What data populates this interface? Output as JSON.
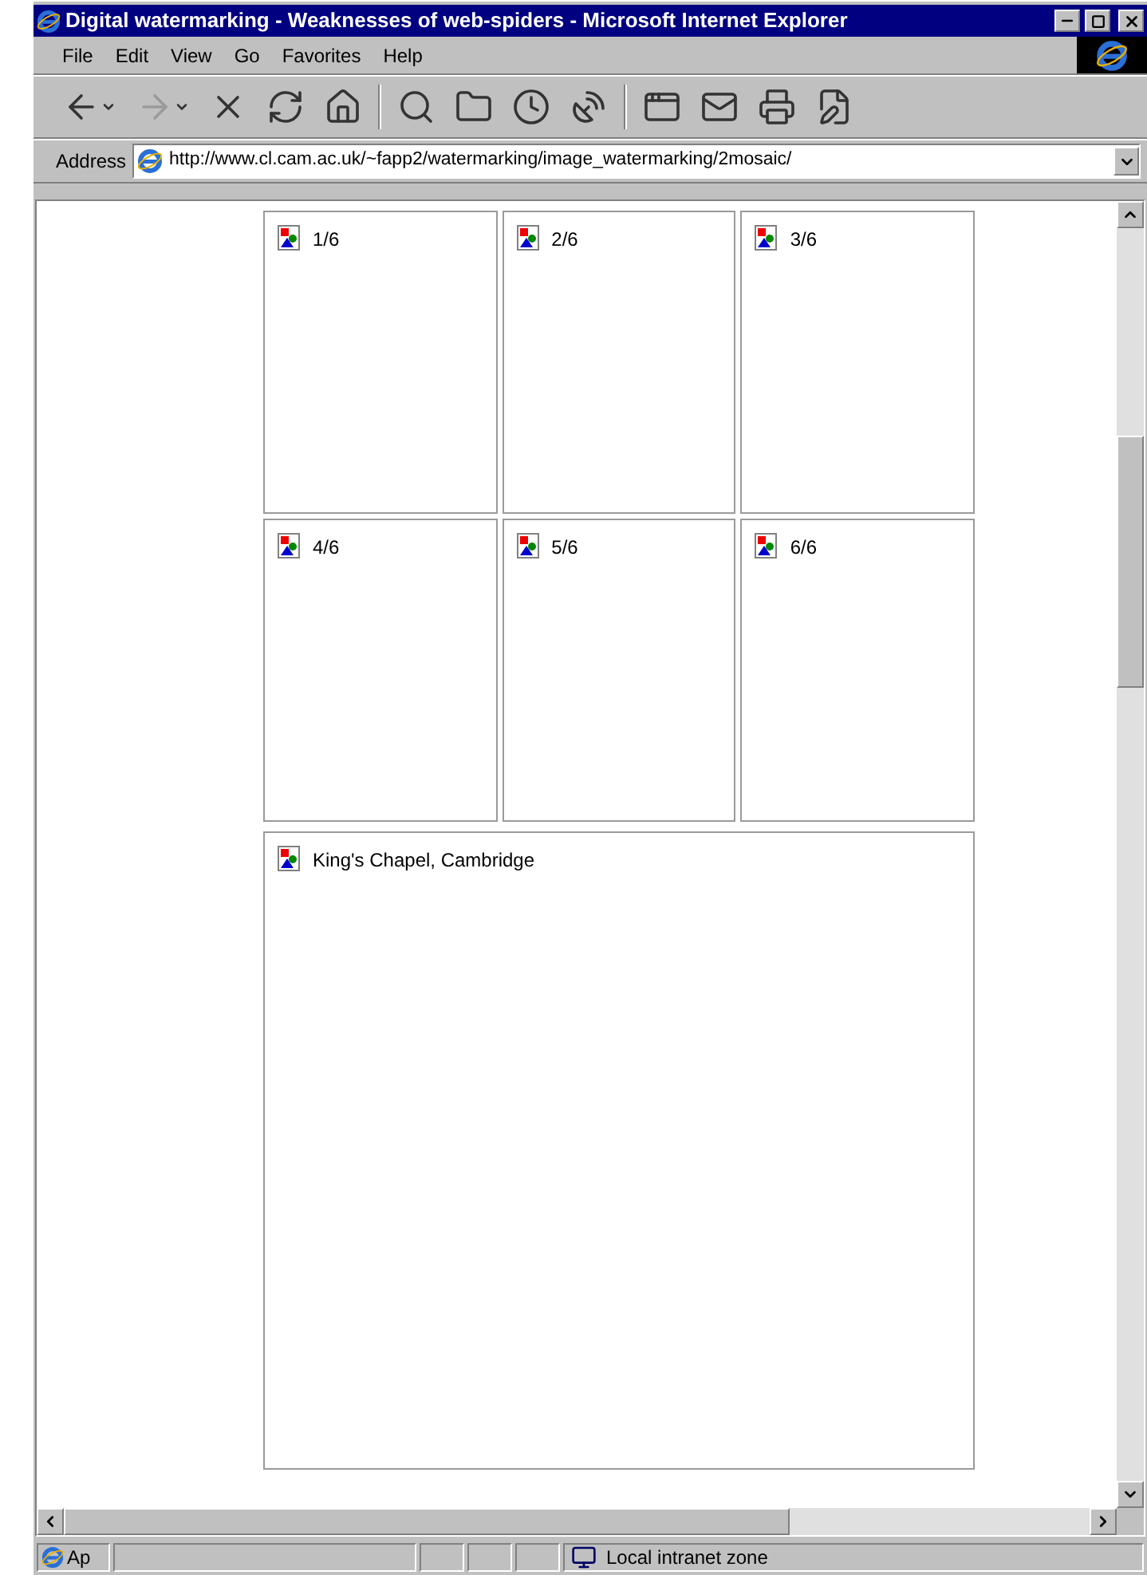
{
  "window": {
    "title": "Digital watermarking - Weaknesses of web-spiders - Microsoft Internet Explorer"
  },
  "menu": [
    "File",
    "Edit",
    "View",
    "Go",
    "Favorites",
    "Help"
  ],
  "toolbar": [
    {
      "kind": "back",
      "disabled": false,
      "dropdown": true
    },
    {
      "kind": "forward",
      "disabled": true,
      "dropdown": true
    },
    {
      "kind": "stop",
      "disabled": false,
      "dropdown": false
    },
    {
      "kind": "refresh",
      "disabled": false,
      "dropdown": false
    },
    {
      "kind": "home",
      "disabled": false,
      "dropdown": false
    },
    {
      "kind": "separator"
    },
    {
      "kind": "search",
      "disabled": false,
      "dropdown": false
    },
    {
      "kind": "favorites",
      "disabled": false,
      "dropdown": false
    },
    {
      "kind": "history",
      "disabled": false,
      "dropdown": false
    },
    {
      "kind": "channels",
      "disabled": false,
      "dropdown": false
    },
    {
      "kind": "separator"
    },
    {
      "kind": "fullscreen",
      "disabled": false,
      "dropdown": false
    },
    {
      "kind": "mail",
      "disabled": false,
      "dropdown": false
    },
    {
      "kind": "print",
      "disabled": false,
      "dropdown": false
    },
    {
      "kind": "edit",
      "disabled": false,
      "dropdown": false
    }
  ],
  "address": {
    "label": "Address",
    "url": "http://www.cl.cam.ac.uk/~fapp2/watermarking/image_watermarking/2mosaic/"
  },
  "tiles": [
    "1/6",
    "2/6",
    "3/6",
    "4/6",
    "5/6",
    "6/6"
  ],
  "main_image": {
    "alt": "King's Chapel, Cambridge"
  },
  "status_bar": {
    "text": "Ap",
    "zone": "Local intranet zone"
  }
}
